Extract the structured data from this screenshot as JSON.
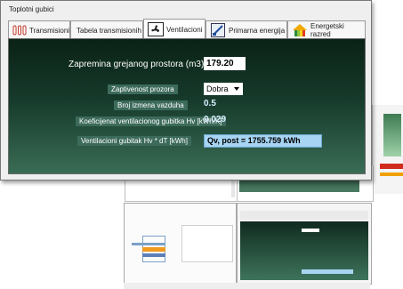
{
  "window": {
    "title": "Toplotni gubici"
  },
  "tabs": [
    {
      "label": "Transmisioni",
      "icon": "radiator-icon",
      "active": false
    },
    {
      "label": "Tabela transmisionih",
      "icon": "",
      "active": false
    },
    {
      "label": "Ventilacioni",
      "icon": "fan-icon",
      "active": true
    },
    {
      "label": "Primarna energija",
      "icon": "energy-meter-icon",
      "active": false
    },
    {
      "label": "Energetski razred",
      "icon": "energy-class-house-icon",
      "active": false
    }
  ],
  "ventilation": {
    "volume_label": "Zapremina grejanog prostora (m3)",
    "volume_value": "179.20",
    "sealing_label": "Zaptivenost prozora",
    "sealing_value": "Dobra",
    "air_exchange_label": "Broj izmena vazduha",
    "air_exchange_value": "0.5",
    "coef_label": "Koeficijenat ventilacionog gubitka Hv [kWh/K]",
    "coef_value": "0.029",
    "loss_label": "Ventilacioni gubitak Hv * dT [kWh]",
    "loss_value": "Qv, post = 1755.759 kWh"
  },
  "colors": {
    "panel_top": "#0a2216",
    "panel_bottom": "#3a6c55",
    "label_chip": "#3d6b5b",
    "result_box": "#a6d4f2"
  }
}
